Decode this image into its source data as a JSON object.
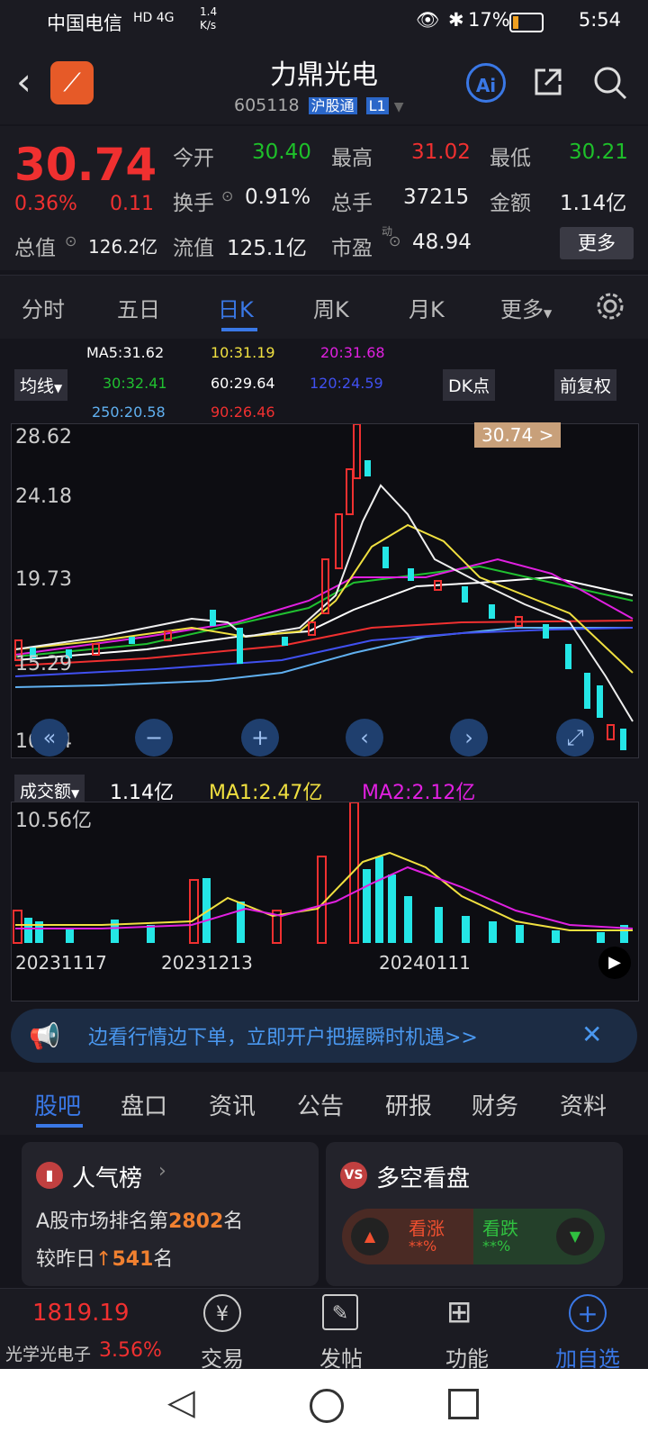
{
  "status": {
    "carrier": "中国电信",
    "net": "HD 4G",
    "speed": "1.4\nK/s",
    "battery": "17%",
    "time": "5:54"
  },
  "header": {
    "title": "力鼎光电",
    "code": "605118",
    "tag1": "沪股通",
    "tag2": "L1",
    "ai": "Ai"
  },
  "quote": {
    "price": "30.74",
    "pct": "0.36%",
    "chg": "0.11",
    "open_l": "今开",
    "open": "30.40",
    "high_l": "最高",
    "high": "31.02",
    "low_l": "最低",
    "low": "30.21",
    "turn_l": "换手",
    "turn": "0.91%",
    "vol_l": "总手",
    "vol": "37215",
    "amt_l": "金额",
    "amt": "1.14亿",
    "mcap_l": "总值",
    "mcap": "126.2亿",
    "fcap_l": "流值",
    "fcap": "125.1亿",
    "pe_l": "市盈",
    "pe": "48.94",
    "more": "更多"
  },
  "tabs": [
    "分时",
    "五日",
    "日K",
    "周K",
    "月K",
    "更多"
  ],
  "ma": {
    "ma5": "MA5:31.62",
    "ma10": "10:31.19",
    "ma20": "20:31.68",
    "ma30": "30:32.41",
    "ma60": "60:29.64",
    "ma120": "120:24.59",
    "ma250": "250:20.58",
    "ma90": "90:26.46"
  },
  "controls": {
    "avg": "均线",
    "dk": "DK点",
    "fq": "前复权"
  },
  "chart": {
    "y1": "28.62",
    "y2": "24.18",
    "y3": "19.73",
    "y4": "15.29",
    "y5": "10.84",
    "badge": "30.74 >"
  },
  "volume": {
    "label": "成交额",
    "val": "1.14亿",
    "ma1": "MA1:2.47亿",
    "ma2": "MA2:2.12亿",
    "top": "10.56亿",
    "d1": "20231117",
    "d2": "20231213",
    "d3": "20240111"
  },
  "banner": "边看行情边下单，立即开户把握瞬时机遇>>",
  "btabs": [
    "股吧",
    "盘口",
    "资讯",
    "公告",
    "研报",
    "财务",
    "资料"
  ],
  "card1": {
    "title": "人气榜",
    "l1a": "A股市场排名第",
    "rank": "2802",
    "l1b": "名",
    "l2a": "较昨日",
    "up": "541",
    "l2b": "名"
  },
  "card2": {
    "title": "多空看盘",
    "bull": "看涨",
    "bear": "看跌",
    "bullv": "**%",
    "bearv": "**%"
  },
  "footer": {
    "idx": "1819.19",
    "sector": "光学光电子",
    "sectpct": "3.56%",
    "trade": "交易",
    "post": "发帖",
    "func": "功能",
    "add": "加自选"
  }
}
